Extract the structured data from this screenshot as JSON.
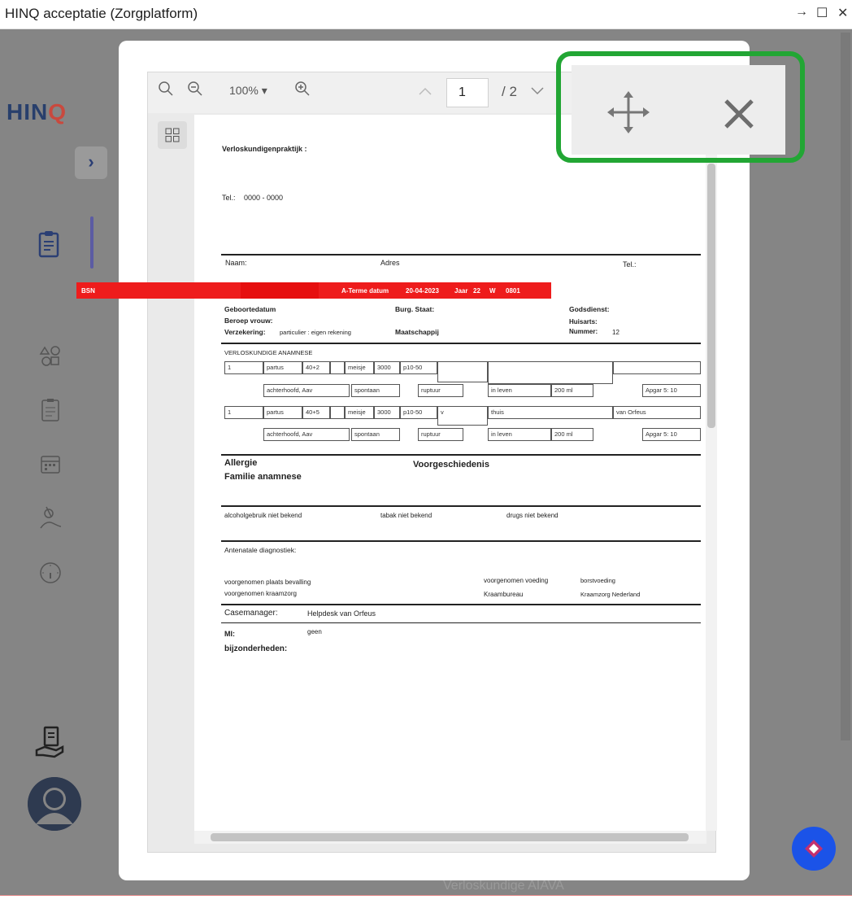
{
  "window": {
    "title": "HINQ acceptatie (Zorgplatform)",
    "controls": {
      "snap": "→",
      "maximize": "☐",
      "close": "✕"
    }
  },
  "sidebar": {
    "logo_text": "HIN",
    "logo_mark": "Q",
    "toggle": "›"
  },
  "viewer": {
    "zoom": "100% ▾",
    "page_current": "1",
    "page_total": "/ 2"
  },
  "document": {
    "practice_label": "Verloskundigenpraktijk :",
    "tel_label": "Tel.:",
    "tel_value": "0000 - 0000",
    "naam_label": "Naam:",
    "adres_label": "Adres",
    "tel2_label": "Tel.:",
    "band_left": "BSN",
    "band_a_terme": "A-Terme datum",
    "band_date": "20-04-2023",
    "band_jaar": "Jaar",
    "band_nr_label": "22",
    "band_w": "W",
    "band_code": "0801",
    "geboortedatum": "Geboortedatum",
    "burg_staat": "Burg. Staat:",
    "godsdienst": "Godsdienst:",
    "beroep_vrouw": "Beroep vrouw:",
    "huisarts": "Huisarts:",
    "verzekering_label": "Verzekering:",
    "verzekering_value": "particulier : eigen rekening",
    "maatschappij": "Maatschappij",
    "nummer_label": "Nummer:",
    "nummer_value": "12",
    "anamnese_title": "VERLOSKUNDIGE ANAMNESE",
    "table_rows": [
      [
        "1",
        "partus",
        "40+2",
        "",
        "meisje",
        "3000",
        "p10-50",
        "",
        "",
        ""
      ],
      [
        "",
        "achterhoofd, Aav",
        "spontaan",
        "ruptuur",
        "in leven",
        "200 ml",
        "Apgar 5: 10"
      ],
      [
        "1",
        "partus",
        "40+5",
        "",
        "meisje",
        "3000",
        "p10-50",
        "v",
        "thuis",
        "van Orfeus"
      ],
      [
        "",
        "achterhoofd, Aav",
        "spontaan",
        "ruptuur",
        "in leven",
        "200 ml",
        "Apgar 5: 10"
      ]
    ],
    "allergie": "Allergie",
    "voorgeschiedenis": "Voorgeschiedenis",
    "familie": "Familie anamnese",
    "alcohol": "alcoholgebruik niet bekend",
    "tabak": "tabak niet bekend",
    "drugs": "drugs niet bekend",
    "antenatale": "Antenatale diagnostiek:",
    "plaats_bevalling": "voorgenomen plaats bevalling",
    "voeding_label": "voorgenomen voeding",
    "voeding_value": "borstvoeding",
    "kraamzorg": "voorgenomen kraamzorg",
    "kraambureau_label": "Kraambureau",
    "kraambureau_value": "Kraamzorg Nederland",
    "casemanager_label": "Casemanager:",
    "casemanager_value": "Helpdesk van Orfeus",
    "mi_label": "MI:",
    "mi_value": "geen",
    "bijzonderheden": "bijzonderheden:"
  },
  "bottom": {
    "partial_text": "Verloskundige AIAVA"
  },
  "colors": {
    "highlight": "#22a634",
    "doc_band": "#ee1c1c",
    "fab": "#1b53e8"
  }
}
